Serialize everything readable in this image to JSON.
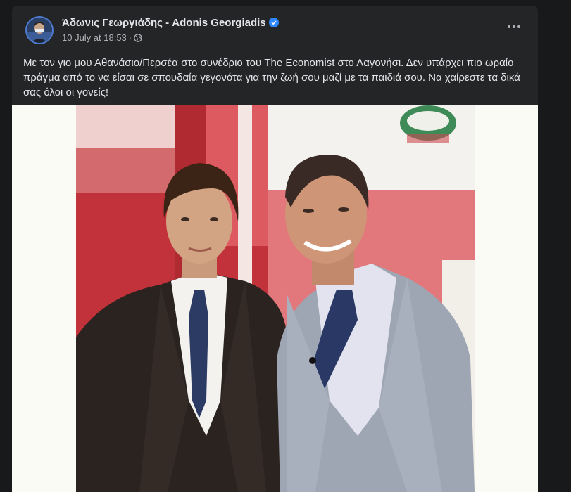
{
  "post": {
    "author_name": "Άδωνις Γεωργιάδης - Adonis Georgiadis",
    "timestamp": "10 July at 18:53",
    "separator": "·",
    "privacy_icon": "globe-icon",
    "verified_icon": "verified-badge-icon",
    "more_icon": "more-options-icon",
    "caption": "Με τον γιο μου Αθανάσιο/Περσέα στο συνέδριο του The Economist στο Λαγονήσι. Δεν υπάρχει πιο ωραίο πράγμα από το να είσαι σε σπουδαία γεγονότα για την ζωή σου μαζί με τα παιδιά σου. Να χαίρεστε τα δικά σας όλοι οι γονείς!"
  },
  "colors": {
    "page_background": "#18191a",
    "card_background": "#242526",
    "primary_text": "#e4e6eb",
    "secondary_text": "#b0b3b8",
    "verified_blue": "#2d88ff",
    "photo_backdrop": "#fbfbf6"
  }
}
